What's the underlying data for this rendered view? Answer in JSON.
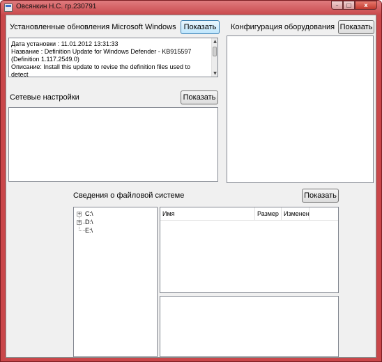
{
  "window": {
    "title": "Овсянкин Н.С. гр.230791"
  },
  "caption_buttons": {
    "minimize": "–",
    "maximize": "□",
    "close": "x"
  },
  "updates": {
    "label": "Установленные обновления Microsoft Windows",
    "button": "Показать",
    "lines": [
      "Дата установки  : 11.01.2012 13:31:33",
      "Название  : Definition Update for Windows Defender - KB915597 (Definition 1.117.2549.0)",
      "Описание: Install this update to revise the definition files used to detect"
    ]
  },
  "hardware": {
    "label": "Конфигурация оборудования",
    "button": "Показать"
  },
  "network": {
    "label": "Сетевые настройки",
    "button": "Показать"
  },
  "filesystem": {
    "label": "Сведения о файловой системе",
    "button": "Показать",
    "drives": [
      "C:\\",
      "D:\\",
      "E:\\"
    ],
    "columns": [
      "Имя",
      "Размер",
      "Изменен"
    ]
  }
}
